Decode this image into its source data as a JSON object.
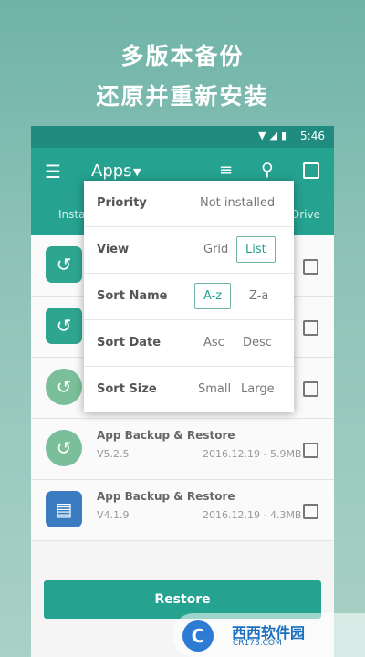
{
  "headline": {
    "line1": "多版本备份",
    "line2": "还原并重新安装"
  },
  "status_bar": {
    "time": "5:46",
    "icons": [
      "wifi-icon",
      "no-signal-icon",
      "battery-icon"
    ]
  },
  "app_bar": {
    "title": "Apps",
    "tabs": {
      "left": "Insta",
      "right": "Drive"
    }
  },
  "popup": {
    "priority": {
      "label": "Priority",
      "value": "Not installed"
    },
    "view": {
      "label": "View",
      "options": [
        "Grid",
        "List"
      ],
      "selected": "List"
    },
    "sort_name": {
      "label": "Sort Name",
      "options": [
        "A-z",
        "Z-a"
      ],
      "selected": "A-z"
    },
    "sort_date": {
      "label": "Sort Date",
      "options": [
        "Asc",
        "Desc"
      ]
    },
    "sort_size": {
      "label": "Sort Size",
      "options": [
        "Small",
        "Large"
      ]
    }
  },
  "list": {
    "items": [
      {
        "name": "",
        "version": "",
        "meta": ""
      },
      {
        "name": "",
        "version": "",
        "meta": ""
      },
      {
        "name": "",
        "version": "",
        "meta": ""
      },
      {
        "name": "App Backup & Restore",
        "version": "V5.2.5",
        "meta": "2016.12.19 - 5.9MB"
      },
      {
        "name": "App Backup & Restore",
        "version": "V4.1.9",
        "meta": "2016.12.19 - 4.3MB"
      }
    ]
  },
  "restore_button": "Restore",
  "watermark": {
    "text": "西西软件园",
    "sub": "CR173.COM"
  },
  "colors": {
    "accent": "#26a290",
    "status": "#1f8c7f",
    "background": "#8fc3b8"
  }
}
